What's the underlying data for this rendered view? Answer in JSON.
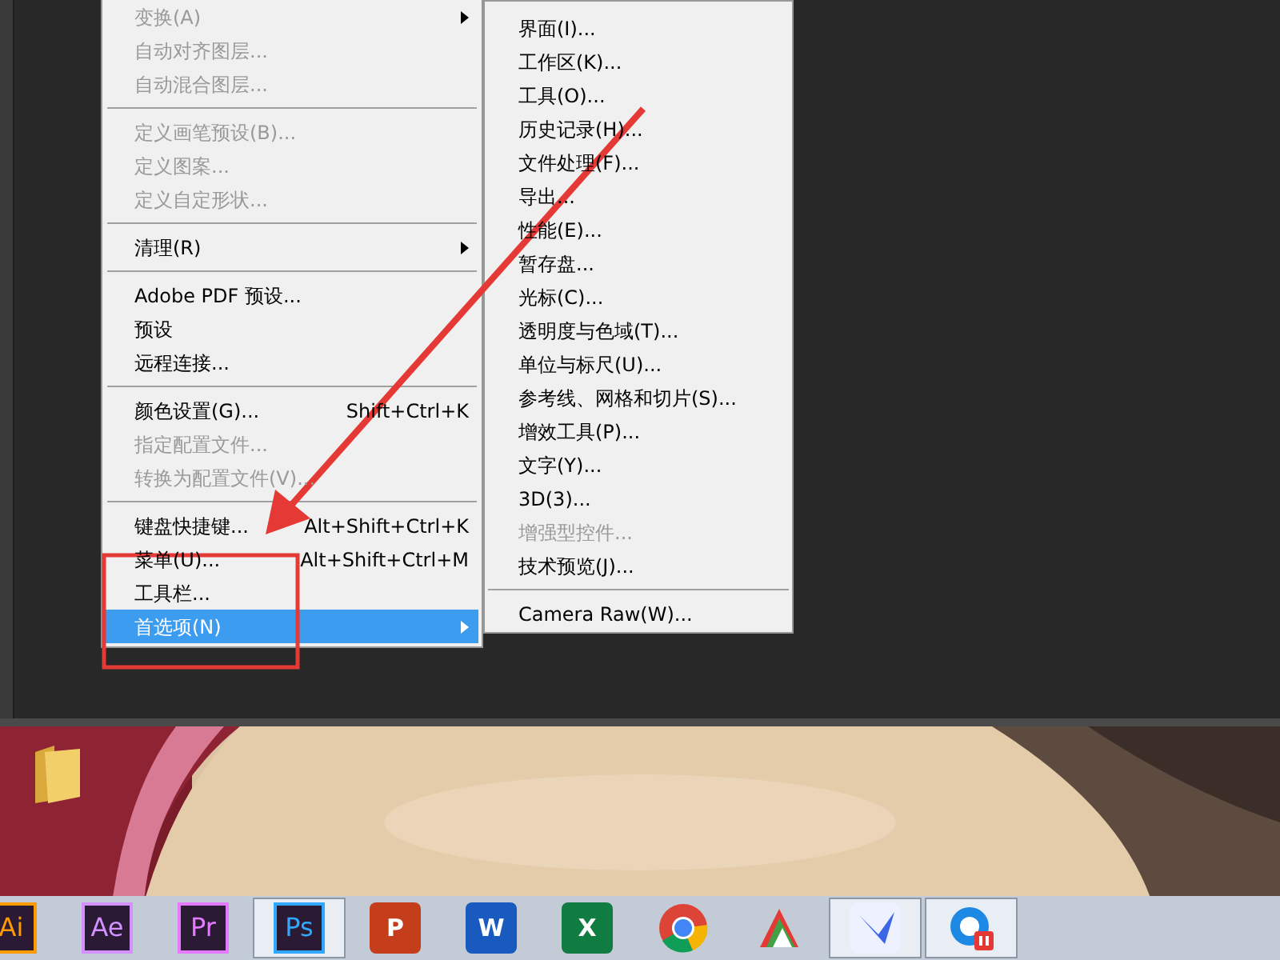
{
  "edit_menu": [
    {
      "kind": "item",
      "label": "变换(A)",
      "disabled": true,
      "submenu": true,
      "selected": false
    },
    {
      "kind": "item",
      "label": "自动对齐图层...",
      "disabled": true,
      "submenu": false,
      "selected": false
    },
    {
      "kind": "item",
      "label": "自动混合图层...",
      "disabled": true,
      "submenu": false,
      "selected": false
    },
    {
      "kind": "separator"
    },
    {
      "kind": "item",
      "label": "定义画笔预设(B)...",
      "disabled": true,
      "submenu": false,
      "selected": false
    },
    {
      "kind": "item",
      "label": "定义图案...",
      "disabled": true,
      "submenu": false,
      "selected": false
    },
    {
      "kind": "item",
      "label": "定义自定形状...",
      "disabled": true,
      "submenu": false,
      "selected": false
    },
    {
      "kind": "separator"
    },
    {
      "kind": "item",
      "label": "清理(R)",
      "disabled": false,
      "submenu": true,
      "selected": false
    },
    {
      "kind": "separator"
    },
    {
      "kind": "item",
      "label": "Adobe PDF 预设...",
      "disabled": false,
      "submenu": false,
      "selected": false
    },
    {
      "kind": "item",
      "label": "预设",
      "disabled": false,
      "submenu": false,
      "selected": false
    },
    {
      "kind": "item",
      "label": "远程连接...",
      "disabled": false,
      "submenu": false,
      "selected": false
    },
    {
      "kind": "separator"
    },
    {
      "kind": "item",
      "label": "颜色设置(G)...",
      "shortcut": "Shift+Ctrl+K",
      "disabled": false,
      "submenu": false,
      "selected": false
    },
    {
      "kind": "item",
      "label": "指定配置文件...",
      "disabled": true,
      "submenu": false,
      "selected": false
    },
    {
      "kind": "item",
      "label": "转换为配置文件(V)...",
      "disabled": true,
      "submenu": false,
      "selected": false
    },
    {
      "kind": "separator"
    },
    {
      "kind": "item",
      "label": "键盘快捷键...",
      "shortcut": "Alt+Shift+Ctrl+K",
      "disabled": false,
      "submenu": false,
      "selected": false
    },
    {
      "kind": "item",
      "label": "菜单(U)...",
      "shortcut": "Alt+Shift+Ctrl+M",
      "disabled": false,
      "submenu": false,
      "selected": false
    },
    {
      "kind": "item",
      "label": "工具栏...",
      "disabled": false,
      "submenu": false,
      "selected": false
    },
    {
      "kind": "item",
      "label": "首选项(N)",
      "disabled": false,
      "submenu": true,
      "selected": true
    }
  ],
  "preferences_submenu": [
    {
      "kind": "item",
      "label": "界面(I)...",
      "disabled": false
    },
    {
      "kind": "item",
      "label": "工作区(K)...",
      "disabled": false
    },
    {
      "kind": "item",
      "label": "工具(O)...",
      "disabled": false
    },
    {
      "kind": "item",
      "label": "历史记录(H)...",
      "disabled": false
    },
    {
      "kind": "item",
      "label": "文件处理(F)...",
      "disabled": false
    },
    {
      "kind": "item",
      "label": "导出...",
      "disabled": false
    },
    {
      "kind": "item",
      "label": "性能(E)...",
      "disabled": false
    },
    {
      "kind": "item",
      "label": "暂存盘...",
      "disabled": false
    },
    {
      "kind": "item",
      "label": "光标(C)...",
      "disabled": false
    },
    {
      "kind": "item",
      "label": "透明度与色域(T)...",
      "disabled": false
    },
    {
      "kind": "item",
      "label": "单位与标尺(U)...",
      "disabled": false
    },
    {
      "kind": "item",
      "label": "参考线、网格和切片(S)...",
      "disabled": false
    },
    {
      "kind": "item",
      "label": "增效工具(P)...",
      "disabled": false
    },
    {
      "kind": "item",
      "label": "文字(Y)...",
      "disabled": false
    },
    {
      "kind": "item",
      "label": "3D(3)...",
      "disabled": false
    },
    {
      "kind": "item",
      "label": "增强型控件...",
      "disabled": true
    },
    {
      "kind": "item",
      "label": "技术预览(J)...",
      "disabled": false
    },
    {
      "kind": "separator"
    },
    {
      "kind": "item",
      "label": "Camera Raw(W)...",
      "disabled": false
    }
  ],
  "taskbar": [
    {
      "kind": "adobe",
      "label": "Ai",
      "color": "#ff9a00",
      "selected": false
    },
    {
      "kind": "adobe",
      "label": "Ae",
      "color": "#d291ff",
      "selected": false
    },
    {
      "kind": "adobe",
      "label": "Pr",
      "color": "#e579ff",
      "selected": false
    },
    {
      "kind": "adobe",
      "label": "Ps",
      "color": "#31a8ff",
      "selected": true
    },
    {
      "kind": "office",
      "label": "P",
      "color": "#c43e1c",
      "selected": false
    },
    {
      "kind": "office",
      "label": "W",
      "color": "#185abd",
      "selected": false
    },
    {
      "kind": "office",
      "label": "X",
      "color": "#107c41",
      "selected": false
    },
    {
      "kind": "browser",
      "selected": false
    },
    {
      "kind": "tool",
      "selected": false
    },
    {
      "kind": "bird",
      "selected": true
    },
    {
      "kind": "sync",
      "selected": true
    }
  ]
}
